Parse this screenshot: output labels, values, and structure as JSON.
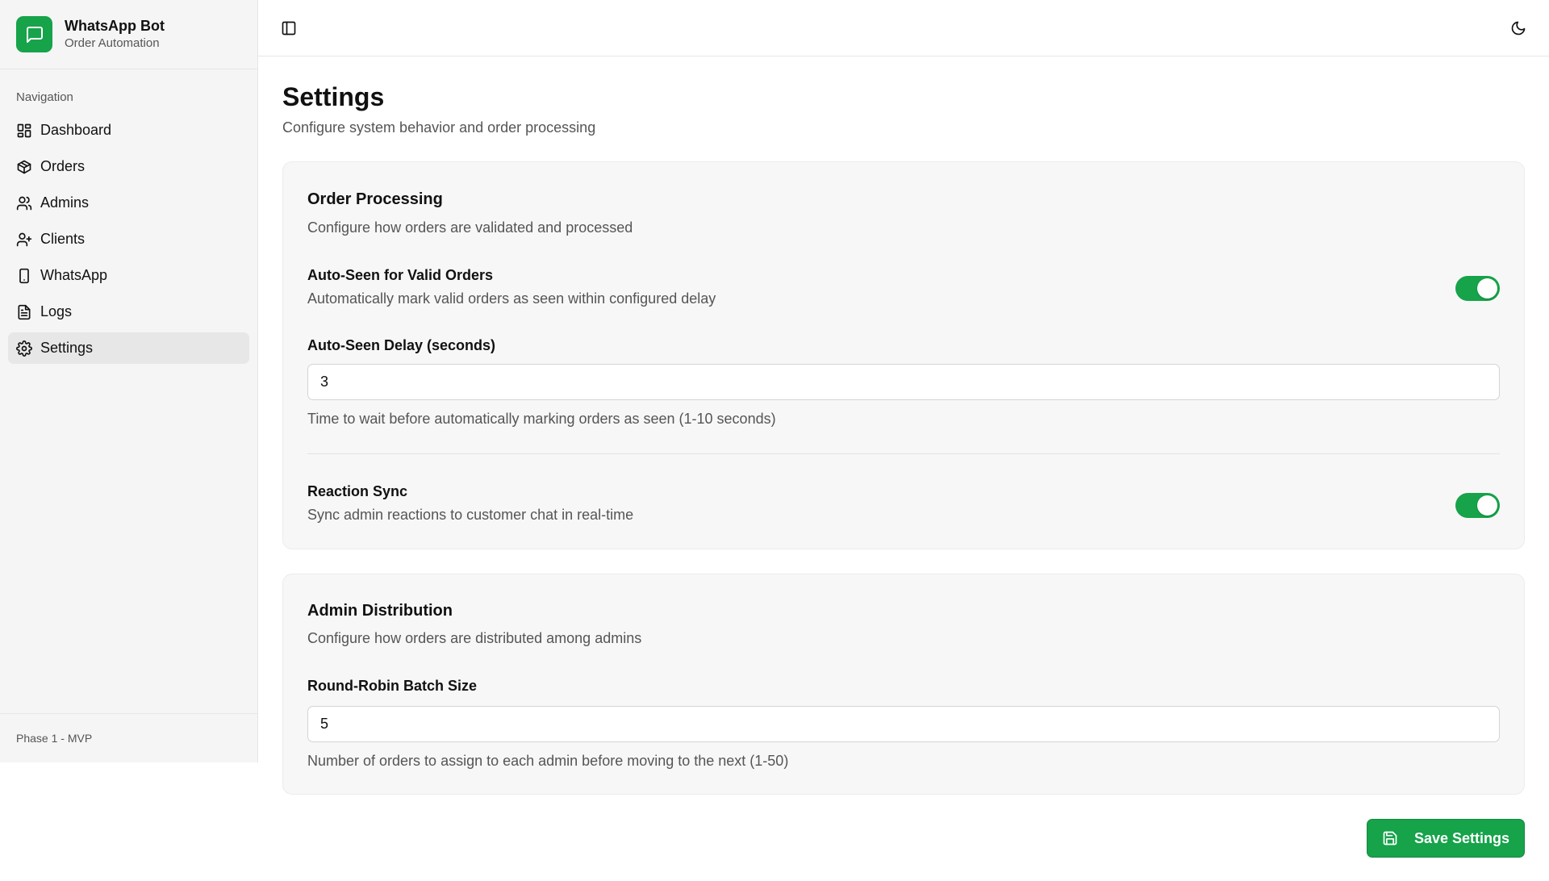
{
  "brand": {
    "title": "WhatsApp Bot",
    "subtitle": "Order Automation",
    "icon": "message-square-icon"
  },
  "sidebar": {
    "heading": "Navigation",
    "items": [
      {
        "label": "Dashboard",
        "icon": "layout-dashboard-icon",
        "active": false
      },
      {
        "label": "Orders",
        "icon": "package-icon",
        "active": false
      },
      {
        "label": "Admins",
        "icon": "users-icon",
        "active": false
      },
      {
        "label": "Clients",
        "icon": "user-plus-icon",
        "active": false
      },
      {
        "label": "WhatsApp",
        "icon": "smartphone-icon",
        "active": false
      },
      {
        "label": "Logs",
        "icon": "file-text-icon",
        "active": false
      },
      {
        "label": "Settings",
        "icon": "settings-icon",
        "active": true
      }
    ],
    "footer": "Phase 1 - MVP"
  },
  "topbar": {
    "left_icon": "panel-left-icon",
    "right_icon": "moon-icon"
  },
  "page": {
    "title": "Settings",
    "subtitle": "Configure system behavior and order processing"
  },
  "order_processing": {
    "title": "Order Processing",
    "description": "Configure how orders are validated and processed",
    "auto_seen": {
      "label": "Auto-Seen for Valid Orders",
      "description": "Automatically mark valid orders as seen within configured delay",
      "enabled": true
    },
    "auto_seen_delay": {
      "label": "Auto-Seen Delay (seconds)",
      "value": "3",
      "help": "Time to wait before automatically marking orders as seen (1-10 seconds)"
    },
    "reaction_sync": {
      "label": "Reaction Sync",
      "description": "Sync admin reactions to customer chat in real-time",
      "enabled": true
    }
  },
  "admin_distribution": {
    "title": "Admin Distribution",
    "description": "Configure how orders are distributed among admins",
    "batch_size": {
      "label": "Round-Robin Batch Size",
      "value": "5",
      "help": "Number of orders to assign to each admin before moving to the next (1-50)"
    }
  },
  "actions": {
    "save_label": "Save Settings",
    "save_icon": "save-icon"
  },
  "colors": {
    "accent": "#16a34a",
    "sidebar_bg": "#f5f5f5",
    "card_bg": "#f7f7f7",
    "active_nav_bg": "#e7e7e7"
  }
}
